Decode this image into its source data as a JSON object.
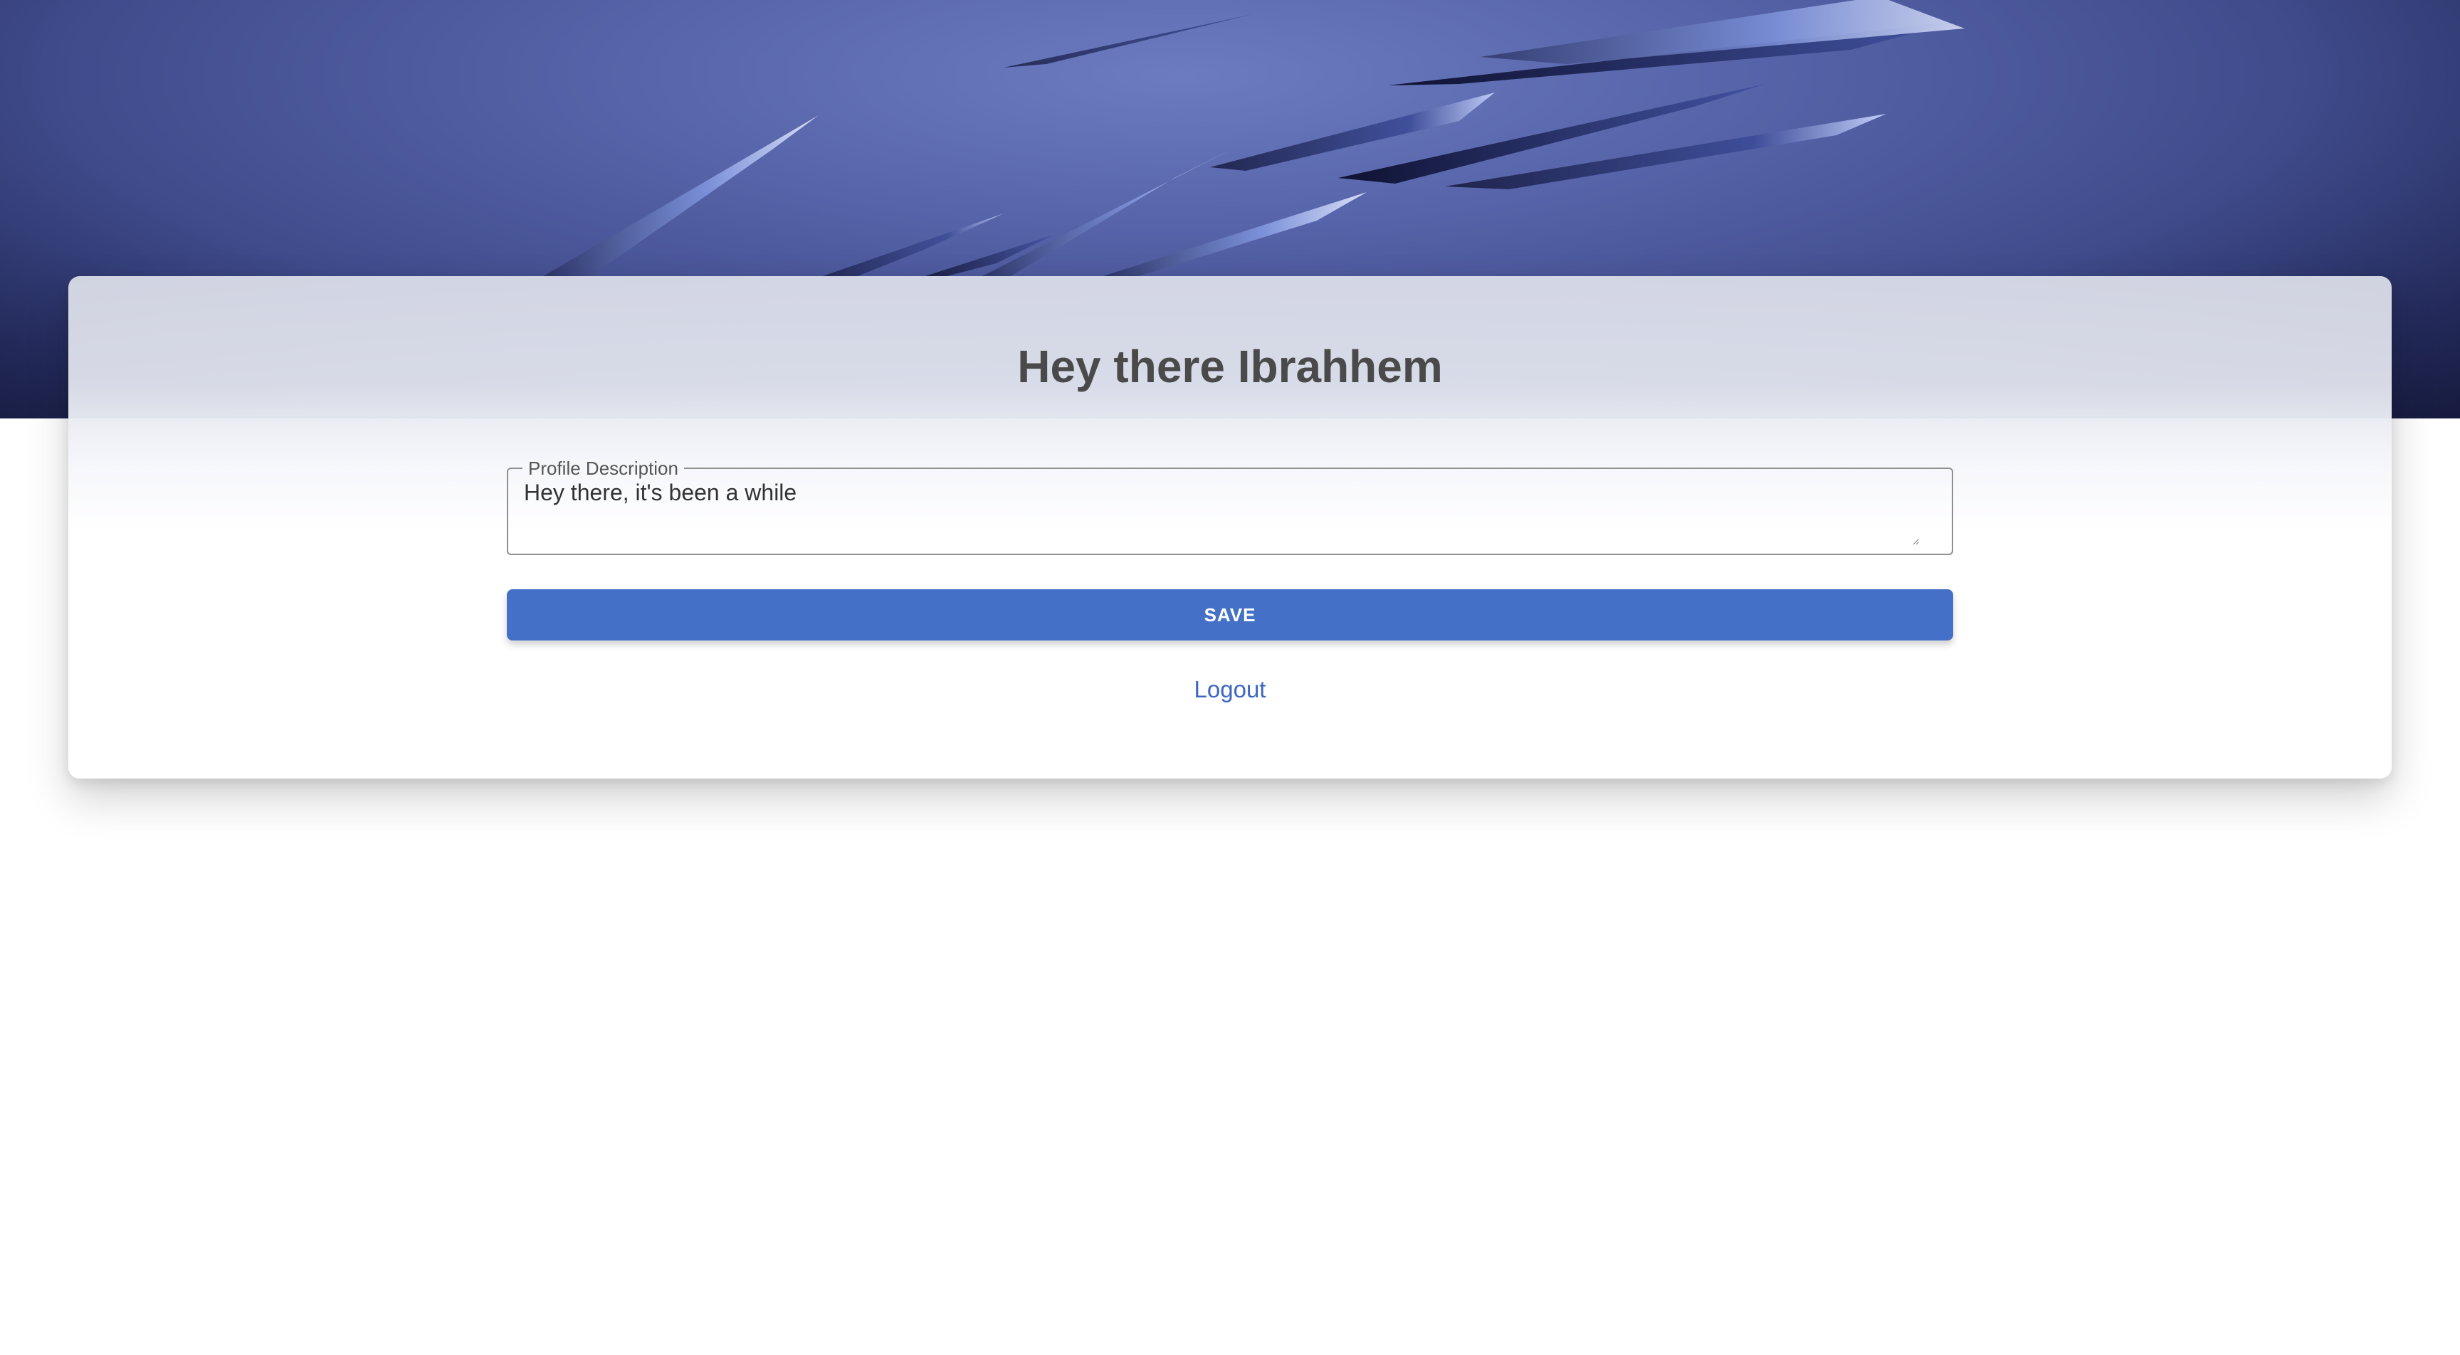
{
  "profile": {
    "greeting": "Hey there Ibrahhem",
    "description_label": "Profile Description",
    "description_value": "Hey there, it's been a while",
    "save_label": "SAVE",
    "logout_label": "Logout"
  },
  "colors": {
    "accent": "#4570c7",
    "link": "#3d66c2",
    "title": "#4a4a4a",
    "hero_base": "#4a5799"
  }
}
